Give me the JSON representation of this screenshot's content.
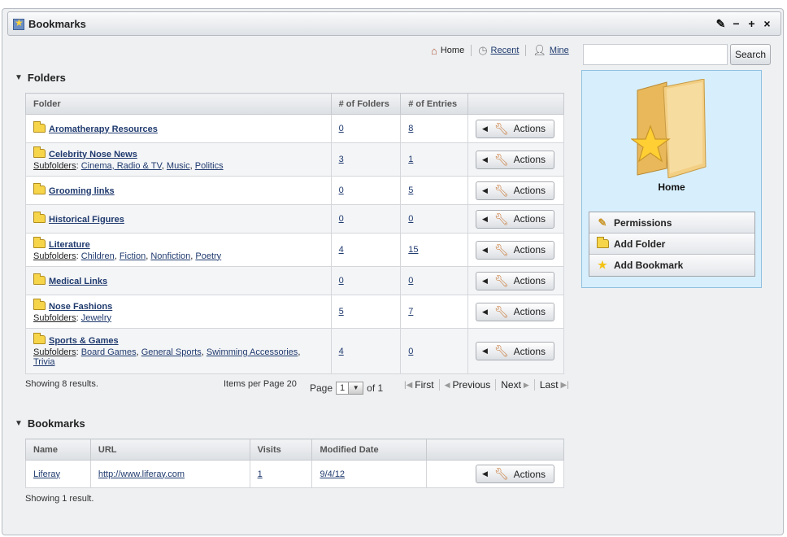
{
  "window": {
    "title": "Bookmarks",
    "controls": [
      "✎",
      "−",
      "+",
      "×"
    ]
  },
  "topnav": [
    {
      "label": "Home",
      "icon": "house-icon"
    },
    {
      "label": "Recent",
      "icon": "clock-icon"
    },
    {
      "label": "Mine",
      "icon": "user-icon"
    }
  ],
  "search": {
    "button": "Search",
    "value": ""
  },
  "folders_section": {
    "title": "Folders",
    "columns": [
      "Folder",
      "# of Folders",
      "# of Entries",
      ""
    ],
    "action_label": "Actions",
    "subfolders_label": "Subfolders",
    "rows": [
      {
        "name": "Aromatherapy Resources",
        "folders": "0",
        "entries": "8",
        "subfolders": []
      },
      {
        "name": "Celebrity Nose News",
        "folders": "3",
        "entries": "1",
        "subfolders": [
          "Cinema, Radio & TV",
          "Music",
          "Politics"
        ]
      },
      {
        "name": "Grooming links",
        "folders": "0",
        "entries": "5",
        "subfolders": []
      },
      {
        "name": "Historical Figures",
        "folders": "0",
        "entries": "0",
        "subfolders": []
      },
      {
        "name": "Literature",
        "folders": "4",
        "entries": "15",
        "subfolders": [
          "Children",
          "Fiction",
          "Nonfiction",
          "Poetry"
        ]
      },
      {
        "name": "Medical Links",
        "folders": "0",
        "entries": "0",
        "subfolders": []
      },
      {
        "name": "Nose Fashions",
        "folders": "5",
        "entries": "7",
        "subfolders": [
          "Jewelry"
        ]
      },
      {
        "name": "Sports & Games",
        "folders": "4",
        "entries": "0",
        "subfolders": [
          "Board Games",
          "General Sports",
          "Swimming Accessories",
          "Trivia"
        ]
      }
    ],
    "results": "Showing 8 results.",
    "items_per_page": "Items per Page 20",
    "page_label": "Page",
    "page_value": "1",
    "page_of": "of 1",
    "nav": {
      "first": "First",
      "previous": "Previous",
      "next": "Next",
      "last": "Last"
    }
  },
  "bookmarks_section": {
    "title": "Bookmarks",
    "columns": [
      "Name",
      "URL",
      "Visits",
      "Modified Date",
      ""
    ],
    "rows": [
      {
        "name": "Liferay",
        "url": "http://www.liferay.com",
        "visits": "1",
        "modified": "9/4/12"
      }
    ],
    "results": "Showing 1 result."
  },
  "side_panel": {
    "title": "Home",
    "menu": [
      {
        "label": "Permissions",
        "icon": "permissions-icon"
      },
      {
        "label": "Add Folder",
        "icon": "add-folder-icon"
      },
      {
        "label": "Add Bookmark",
        "icon": "add-bookmark-icon"
      }
    ]
  }
}
